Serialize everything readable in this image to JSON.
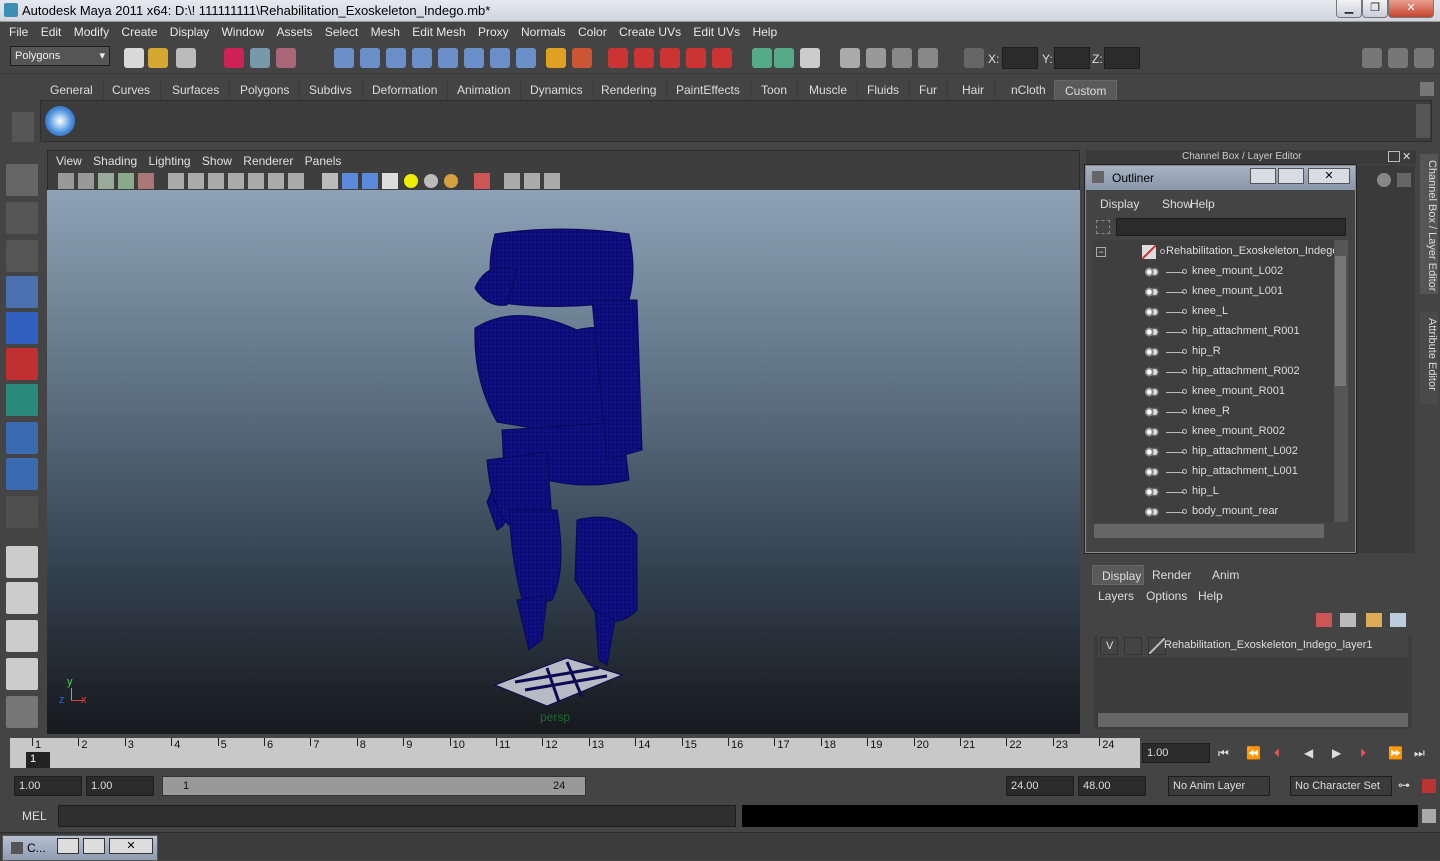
{
  "window": {
    "title": "Autodesk Maya 2011 x64: D:\\! 111111111\\Rehabilitation_Exoskeleton_Indego.mb*",
    "min": "▁",
    "max": "❐",
    "close": "✕"
  },
  "menu": [
    "File",
    "Edit",
    "Modify",
    "Create",
    "Display",
    "Window",
    "Assets",
    "Select",
    "Mesh",
    "Edit Mesh",
    "Proxy",
    "Normals",
    "Color",
    "Create UVs",
    "Edit UVs",
    "Help"
  ],
  "status": {
    "mode": "Polygons",
    "x_label": "X:",
    "y_label": "Y:",
    "z_label": "Z:"
  },
  "shelf_tabs": [
    "General",
    "Curves",
    "Surfaces",
    "Polygons",
    "Subdivs",
    "Deformation",
    "Animation",
    "Dynamics",
    "Rendering",
    "PaintEffects",
    "Toon",
    "Muscle",
    "Fluids",
    "Fur",
    "Hair",
    "nCloth",
    "Custom"
  ],
  "viewport": {
    "menus": [
      "View",
      "Shading",
      "Lighting",
      "Show",
      "Renderer",
      "Panels"
    ],
    "camera": "persp",
    "axis_x": "x",
    "axis_y": "y",
    "axis_z": "z",
    "mesh_color": "#0d0d7a"
  },
  "outliner": {
    "title": "Outliner",
    "menus": [
      "Display",
      "Show",
      "Help"
    ],
    "root": "Rehabilitation_Exoskeleton_Indego",
    "items": [
      "knee_mount_L002",
      "knee_mount_L001",
      "knee_L",
      "hip_attachment_R001",
      "hip_R",
      "hip_attachment_R002",
      "knee_mount_R001",
      "knee_R",
      "knee_mount_R002",
      "hip_attachment_L002",
      "hip_attachment_L001",
      "hip_L",
      "body_mount_rear"
    ]
  },
  "channel_box": {
    "title": "Channel Box / Layer Editor",
    "side_tab1": "Channel Box / Layer Editor",
    "side_tab2": "Attribute Editor"
  },
  "layers": {
    "tabs": [
      "Display",
      "Render",
      "Anim"
    ],
    "menus": [
      "Layers",
      "Options",
      "Help"
    ],
    "visible": "V",
    "layer_name": "Rehabilitation_Exoskeleton_Indego_layer1"
  },
  "timeline": {
    "ticks": [
      "1",
      "2",
      "3",
      "4",
      "5",
      "6",
      "7",
      "8",
      "9",
      "10",
      "11",
      "12",
      "13",
      "14",
      "15",
      "16",
      "17",
      "18",
      "19",
      "20",
      "21",
      "22",
      "23",
      "24"
    ],
    "current_frame": "1",
    "current_field": "1.00"
  },
  "range": {
    "start": "1.00",
    "start2": "1.00",
    "slider_start": "1",
    "slider_end": "24",
    "end": "24.00",
    "end2": "48.00",
    "anim_layer": "No Anim Layer",
    "char_set": "No Character Set"
  },
  "cmd": {
    "label": "MEL"
  },
  "taskbar": {
    "label": "C..."
  }
}
